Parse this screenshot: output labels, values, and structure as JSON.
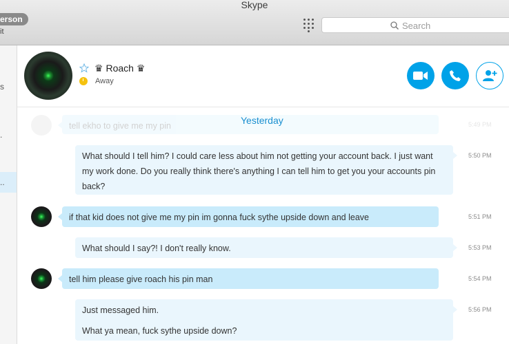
{
  "window": {
    "title": "Skype",
    "user_pill": "erson",
    "user_sub": "it"
  },
  "search": {
    "placeholder": "Search"
  },
  "sidebar": {
    "items": [
      {
        "label": "s"
      },
      {
        "label": "."
      },
      {
        "label": ".."
      }
    ]
  },
  "contact": {
    "name": "Roach",
    "crown_glyph": "♛",
    "status": "Away",
    "status_color": "#f5c20f"
  },
  "actions": {
    "video_icon": "video-call-icon",
    "call_icon": "phone-icon",
    "add_icon": "add-contact-icon",
    "accent": "#00a2e8"
  },
  "chat": {
    "date_divider": "Yesterday",
    "messages": [
      {
        "from": "contact",
        "text": "tell ekho to give me my pin",
        "time": "5:49 PM"
      },
      {
        "from": "me",
        "text": "What should I tell him?  I could care less about him not getting your account back.  I just want my work done.  Do you really think there's anything I can tell him to get you your accounts pin back?",
        "time": "5:50 PM"
      },
      {
        "from": "contact",
        "text": "if that kid does not give me my pin im gonna fuck sythe upside down and leave",
        "time": "5:51 PM"
      },
      {
        "from": "me",
        "text": "What should I say?!  I don't really know.",
        "time": "5:53 PM"
      },
      {
        "from": "contact",
        "text": "tell him please give roach his pin man",
        "time": "5:54 PM"
      },
      {
        "from": "me",
        "text": "Just messaged him.",
        "time": "5:56 PM"
      },
      {
        "from": "me",
        "text": "What ya mean, fuck sythe upside down?",
        "time": ""
      }
    ]
  }
}
